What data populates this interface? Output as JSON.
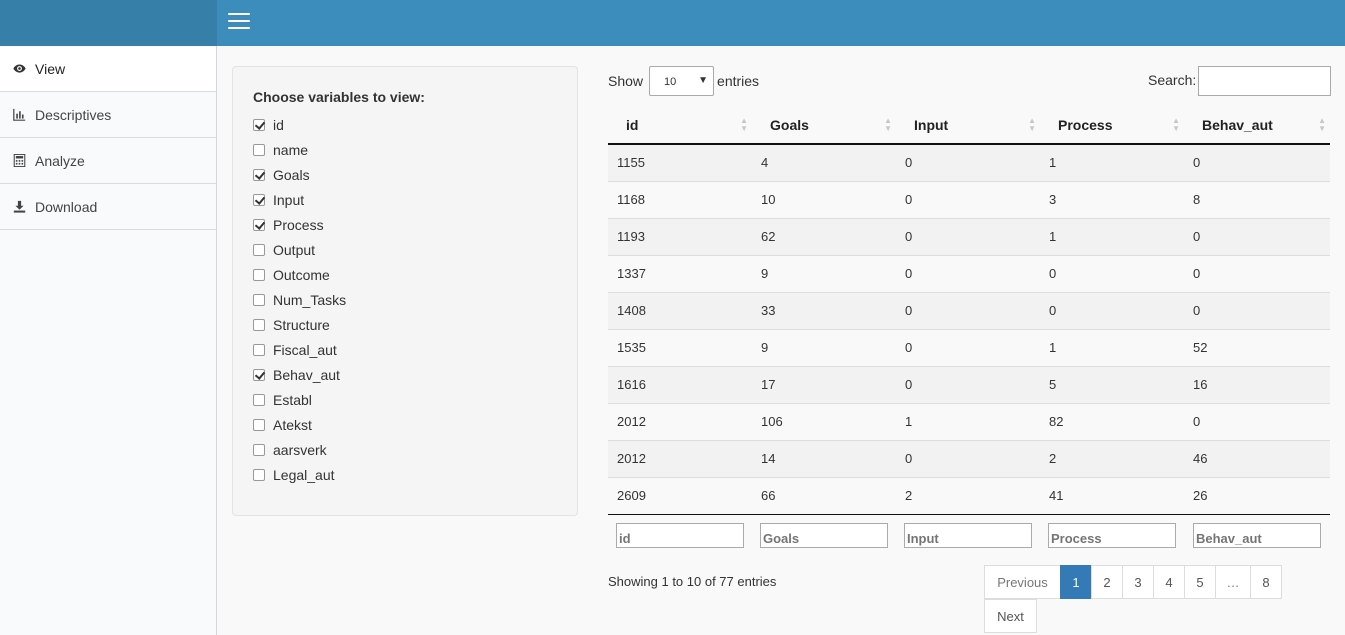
{
  "sidebar": {
    "items": [
      {
        "label": "View",
        "icon": "eye-icon"
      },
      {
        "label": "Descriptives",
        "icon": "bar-chart-icon"
      },
      {
        "label": "Analyze",
        "icon": "calculator-icon"
      },
      {
        "label": "Download",
        "icon": "download-icon"
      }
    ]
  },
  "variables": {
    "title": "Choose variables to view:",
    "items": [
      {
        "label": "id",
        "checked": true
      },
      {
        "label": "name",
        "checked": false
      },
      {
        "label": "Goals",
        "checked": true
      },
      {
        "label": "Input",
        "checked": true
      },
      {
        "label": "Process",
        "checked": true
      },
      {
        "label": "Output",
        "checked": false
      },
      {
        "label": "Outcome",
        "checked": false
      },
      {
        "label": "Num_Tasks",
        "checked": false
      },
      {
        "label": "Structure",
        "checked": false
      },
      {
        "label": "Fiscal_aut",
        "checked": false
      },
      {
        "label": "Behav_aut",
        "checked": true
      },
      {
        "label": "Establ",
        "checked": false
      },
      {
        "label": "Atekst",
        "checked": false
      },
      {
        "label": "aarsverk",
        "checked": false
      },
      {
        "label": "Legal_aut",
        "checked": false
      }
    ]
  },
  "table": {
    "show_label": "Show",
    "length_value": "10",
    "entries_label": "entries",
    "search_label": "Search:",
    "search_value": "",
    "columns": [
      "id",
      "Goals",
      "Input",
      "Process",
      "Behav_aut"
    ],
    "rows": [
      [
        "1155",
        "4",
        "0",
        "1",
        "0"
      ],
      [
        "1168",
        "10",
        "0",
        "3",
        "8"
      ],
      [
        "1193",
        "62",
        "0",
        "1",
        "0"
      ],
      [
        "1337",
        "9",
        "0",
        "0",
        "0"
      ],
      [
        "1408",
        "33",
        "0",
        "0",
        "0"
      ],
      [
        "1535",
        "9",
        "0",
        "1",
        "52"
      ],
      [
        "1616",
        "17",
        "0",
        "5",
        "16"
      ],
      [
        "2012",
        "106",
        "1",
        "82",
        "0"
      ],
      [
        "2012",
        "14",
        "0",
        "2",
        "46"
      ],
      [
        "2609",
        "66",
        "2",
        "41",
        "26"
      ]
    ],
    "filter_placeholders": [
      "id",
      "Goals",
      "Input",
      "Process",
      "Behav_aut"
    ],
    "info": "Showing 1 to 10 of 77 entries",
    "pagination": {
      "previous": "Previous",
      "pages": [
        "1",
        "2",
        "3",
        "4",
        "5",
        "…",
        "8"
      ],
      "active_page": "1",
      "next": "Next"
    }
  },
  "colors": {
    "header": "#3c8dbc",
    "logo_area": "#367fa9",
    "active_page": "#337ab7"
  }
}
